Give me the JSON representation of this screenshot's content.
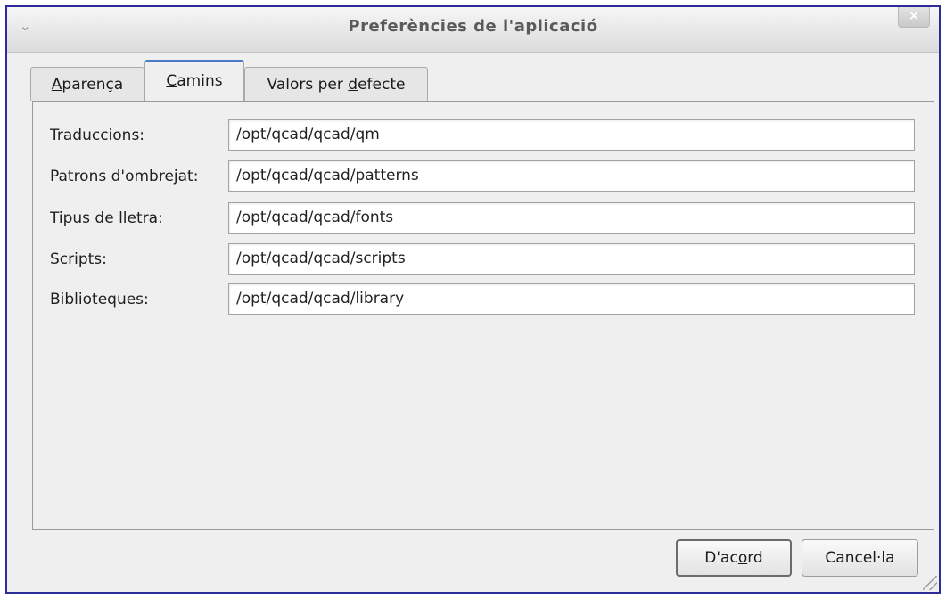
{
  "window": {
    "title": "Preferències de l'aplicació",
    "close_glyph": "×",
    "menu_glyph": "⌄"
  },
  "tabs": [
    {
      "pre": "",
      "ul": "A",
      "post": "parença"
    },
    {
      "pre": "",
      "ul": "C",
      "post": "amins"
    },
    {
      "pre": "Valors per ",
      "ul": "d",
      "post": "efecte"
    }
  ],
  "paths": {
    "translations": {
      "label": "Traduccions:",
      "value": "/opt/qcad/qcad/qm"
    },
    "hatch_patterns": {
      "label": "Patrons d'ombrejat:",
      "value": "/opt/qcad/qcad/patterns"
    },
    "fonts": {
      "label": "Tipus de lletra:",
      "value": "/opt/qcad/qcad/fonts"
    },
    "scripts": {
      "label": "Scripts:",
      "value": "/opt/qcad/qcad/scripts"
    },
    "libraries": {
      "label": "Biblioteques:",
      "value": "/opt/qcad/qcad/library"
    }
  },
  "buttons": {
    "ok": {
      "pre": "D'ac",
      "ul": "o",
      "post": "rd"
    },
    "cancel": "Cancel·la"
  },
  "colors": {
    "window_border": "#2c2c9a",
    "active_tab_accent": "#4a7bc4"
  }
}
